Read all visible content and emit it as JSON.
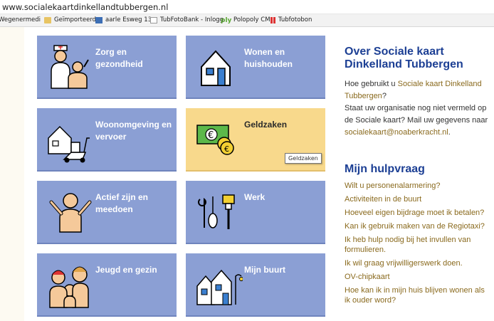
{
  "browser": {
    "url": "www.socialekaartdinkellandtubbergen.nl",
    "bookmarks": [
      {
        "label": "Wegenermedi",
        "icon": "bookmark-icon"
      },
      {
        "label": "Geïmporteerd",
        "icon": "folder-icon"
      },
      {
        "label": "aarle Esweg 13",
        "icon": "calendar-icon"
      },
      {
        "label": "TubFotoBank - Inlogg",
        "icon": "page-icon"
      },
      {
        "label": "Polopoly CM",
        "icon": "polopoly-icon"
      },
      {
        "label": "Tubfotobon",
        "icon": "bars-icon"
      }
    ]
  },
  "tiles": [
    {
      "title": "Zorg en gezondheid",
      "icon": "nurse-patient-icon"
    },
    {
      "title": "Wonen en huishouden",
      "icon": "house-icon"
    },
    {
      "title": "Woonomgeving en vervoer",
      "icon": "mobility-scooter-icon"
    },
    {
      "title": "Geldzaken",
      "icon": "money-icon",
      "tooltip": "Geldzaken"
    },
    {
      "title": "Actief zijn en meedoen",
      "icon": "cheering-person-icon"
    },
    {
      "title": "Werk",
      "icon": "tools-icon"
    },
    {
      "title": "Jeugd en gezin",
      "icon": "family-icon"
    },
    {
      "title": "Mijn buurt",
      "icon": "neighborhood-icon"
    }
  ],
  "sidebar": {
    "about_title": "Over Sociale kaart Dinkelland Tubbergen",
    "about_text_1": "Hoe gebruikt u ",
    "about_link": "Sociale kaart Dinkelland Tubbergen",
    "about_text_2": "?",
    "about_text_3": "Staat uw organisatie nog niet vermeld op de Sociale kaart? Mail uw gegevens naar ",
    "email": "socialekaart@noaberkracht.nl",
    "about_text_4": ".",
    "help_title": "Mijn hulpvraag",
    "help_links": [
      "Wilt u personenalarmering?",
      "Activiteiten in de buurt",
      "Hoeveel eigen bijdrage moet ik betalen?",
      "Kan ik gebruik maken van de Regiotaxi?",
      "Ik heb hulp nodig bij het invullen van formulieren.",
      "Ik wil graag vrijwilligerswerk doen.",
      "OV-chipkaart",
      "Hoe kan ik in mijn huis blijven wonen als ik ouder word?"
    ]
  },
  "colors": {
    "tile": "#8b9fd4",
    "tile_active": "#f8d98c",
    "heading": "#1c3f94",
    "link": "#8a6a1e"
  }
}
